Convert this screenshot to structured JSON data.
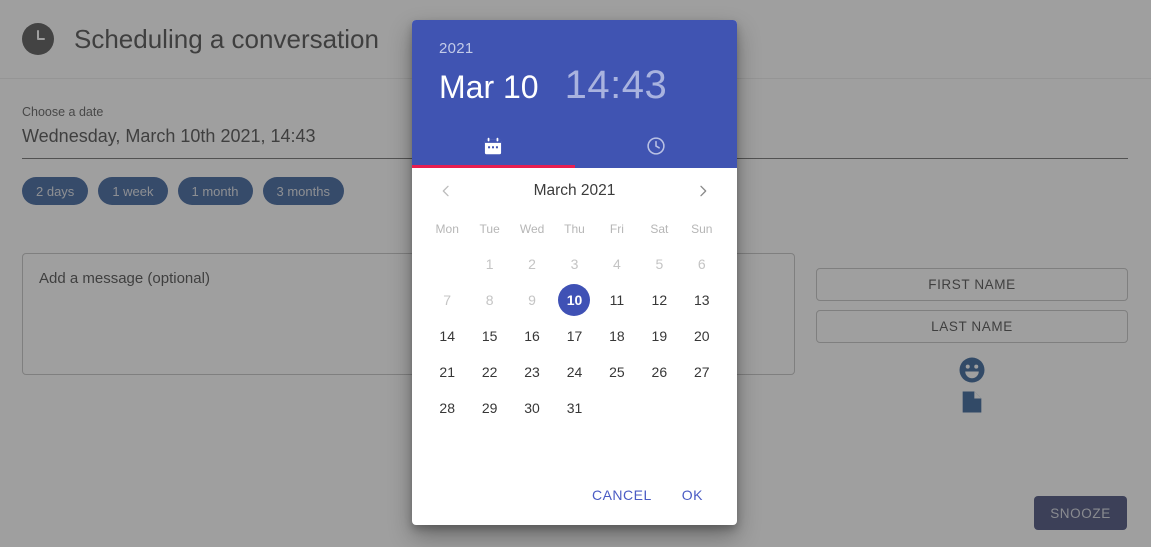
{
  "app": {
    "icon": "clock-icon",
    "title": "Scheduling a conversation"
  },
  "form": {
    "date_label": "Choose a date",
    "date_value": "Wednesday, March 10th 2021, 14:43",
    "quick_chips": [
      "2 days",
      "1 week",
      "1 month",
      "3 months"
    ],
    "message_placeholder": "Add a message (optional)",
    "message_value": "",
    "first_name_label": "FIRST NAME",
    "last_name_label": "LAST NAME",
    "emoji_icon": "smiley-icon",
    "attachment_icon": "document-icon",
    "snooze_label": "SNOOZE"
  },
  "picker": {
    "year": "2021",
    "date": "Mar 10",
    "time": "14:43",
    "tabs": [
      {
        "name": "calendar-tab",
        "icon": "calendar-icon",
        "active": true
      },
      {
        "name": "clock-tab",
        "icon": "clock-icon",
        "active": false
      }
    ],
    "month_label": "March 2021",
    "prev_icon": "chevron-left-icon",
    "next_icon": "chevron-right-icon",
    "weekdays": [
      "Mon",
      "Tue",
      "Wed",
      "Thu",
      "Fri",
      "Sat",
      "Sun"
    ],
    "leading_blanks": 0,
    "weeks": [
      [
        null,
        "1",
        "2",
        "3",
        "4",
        "5",
        "6"
      ],
      [
        "7",
        "8",
        "9",
        "10",
        "11",
        "12",
        "13"
      ],
      [
        "14",
        "15",
        "16",
        "17",
        "18",
        "19",
        "20"
      ],
      [
        "21",
        "22",
        "23",
        "24",
        "25",
        "26",
        "27"
      ],
      [
        "28",
        "29",
        "30",
        "31",
        null,
        null,
        null
      ]
    ],
    "disabled_days": [
      "1",
      "2",
      "3",
      "4",
      "5",
      "6",
      "7",
      "8",
      "9"
    ],
    "selected_day": "10",
    "cancel_label": "CANCEL",
    "ok_label": "OK"
  },
  "colors": {
    "accent_indigo": "#3f51b5",
    "header_indigo": "#4054b2",
    "tab_indicator_pink": "#e91e50",
    "chip_navy": "#18458a",
    "snooze_navy": "#252d63",
    "icon_navy": "#0f4484"
  }
}
